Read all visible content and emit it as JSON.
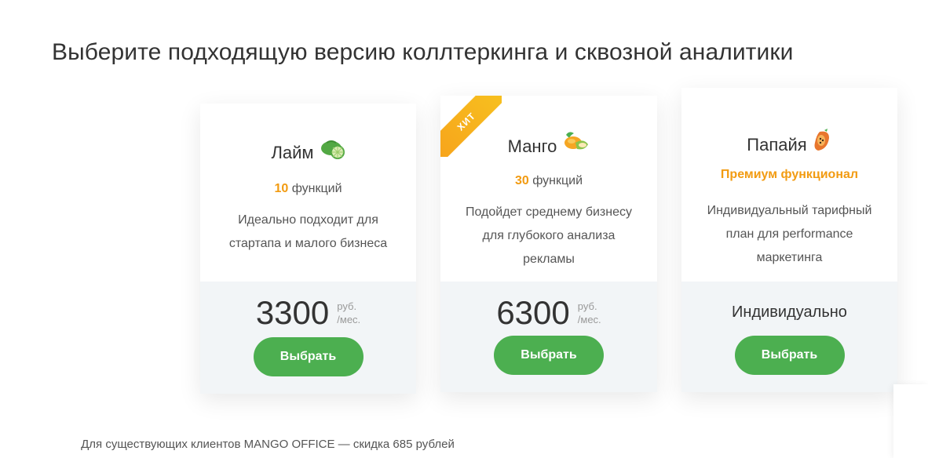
{
  "header": {
    "title": "Выберите подходящую версию коллтеркинга и сквозной аналитики"
  },
  "plans": [
    {
      "name": "Лайм",
      "icon": "lime-icon",
      "features_count": "10",
      "features_label": "функций",
      "description_lines": [
        "Идеально подходит для",
        "стартапа и малого бизнеса"
      ],
      "price": "3300",
      "price_unit_1": "руб.",
      "price_unit_2": "/мес.",
      "button_label": "Выбрать"
    },
    {
      "name": "Манго",
      "icon": "mango-icon",
      "badge": "ХИТ",
      "features_count": "30",
      "features_label": "функций",
      "description_lines": [
        "Подойдет среднему бизнесу",
        "для глубокого анализа",
        "рекламы"
      ],
      "price": "6300",
      "price_unit_1": "руб.",
      "price_unit_2": "/мес.",
      "button_label": "Выбрать"
    },
    {
      "name": "Папайя",
      "icon": "papaya-icon",
      "features_premium": "Премиум функционал",
      "description_lines": [
        "Индивидуальный тарифный",
        "план для performance",
        "маркетинга"
      ],
      "price_text": "Индивидуально",
      "button_label": "Выбрать"
    }
  ],
  "footer": {
    "note": "Для существующих клиентов MANGO OFFICE — скидка 685 рублей"
  },
  "colors": {
    "accent_orange": "#f29b11",
    "button_green": "#4caf50",
    "card_bottom_bg": "#f2f5f7"
  }
}
